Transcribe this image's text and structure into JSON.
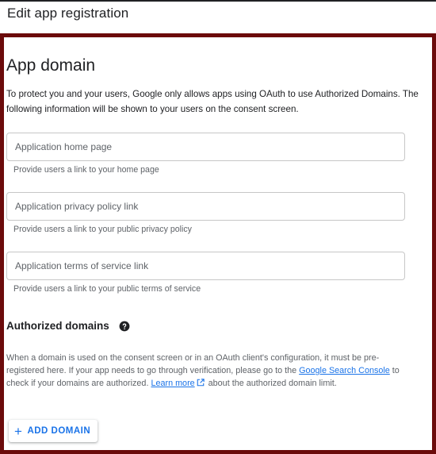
{
  "header": {
    "title": "Edit app registration"
  },
  "app_domain": {
    "title": "App domain",
    "intro": "To protect you and your users, Google only allows apps using OAuth to use Authorized Domains. The following information will be shown to your users on the consent screen.",
    "fields": [
      {
        "placeholder": "Application home page",
        "value": "",
        "hint": "Provide users a link to your home page"
      },
      {
        "placeholder": "Application privacy policy link",
        "value": "",
        "hint": "Provide users a link to your public privacy policy"
      },
      {
        "placeholder": "Application terms of service link",
        "value": "",
        "hint": "Provide users a link to your public terms of service"
      }
    ]
  },
  "authorized_domains": {
    "title": "Authorized domains",
    "help_icon": "help-circle-icon",
    "desc_part1": "When a domain is used on the consent screen or in an OAuth client's configuration, it must be pre-registered here. If your app needs to go through verification, please go to the ",
    "search_console_link": "Google Search Console",
    "desc_part2": " to check if your domains are authorized. ",
    "learn_more_link": "Learn more",
    "desc_part3": " about the authorized domain limit.",
    "add_button": "ADD DOMAIN",
    "add_icon": "plus-icon"
  },
  "colors": {
    "frame": "#6b0b0b",
    "accent": "#1a73e8"
  }
}
